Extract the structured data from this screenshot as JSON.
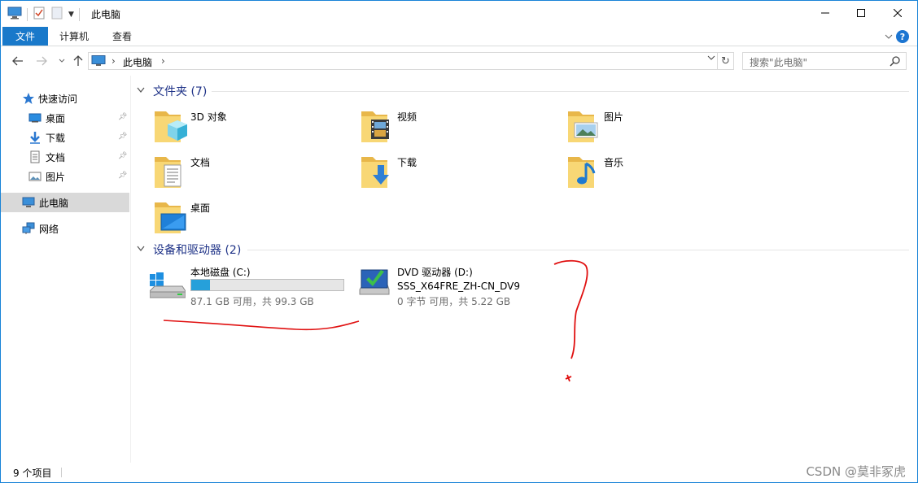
{
  "window": {
    "title": "此电脑",
    "controls": {
      "minimize": "minimize-icon",
      "maximize": "maximize-icon",
      "close": "close-icon"
    }
  },
  "ribbon": {
    "file_tab": "文件",
    "tabs": [
      "计算机",
      "查看"
    ]
  },
  "address": {
    "crumb": "此电脑",
    "search_placeholder": "搜索\"此电脑\""
  },
  "nav": {
    "quick_access": "快速访问",
    "pinned": [
      "桌面",
      "下载",
      "文档",
      "图片"
    ],
    "this_pc": "此电脑",
    "network": "网络"
  },
  "folders": {
    "header": "文件夹 (7)",
    "items": [
      "3D 对象",
      "视频",
      "图片",
      "文档",
      "下载",
      "音乐",
      "桌面"
    ]
  },
  "devices": {
    "header": "设备和驱动器 (2)",
    "c": {
      "name": "本地磁盘 (C:)",
      "free": "87.1 GB 可用，共 99.3 GB",
      "used_fraction": 0.123
    },
    "d": {
      "name": "DVD 驱动器 (D:)",
      "label": "SSS_X64FRE_ZH-CN_DV9",
      "free": "0 字节 可用，共 5.22 GB"
    }
  },
  "status": {
    "count": "9 个项目",
    "watermark": "CSDN @莫非冢虎"
  },
  "colors": {
    "accent": "#1979ca",
    "group_header": "#1e3287",
    "drive_bar": "#26a0da",
    "annotation": "#e01010"
  }
}
